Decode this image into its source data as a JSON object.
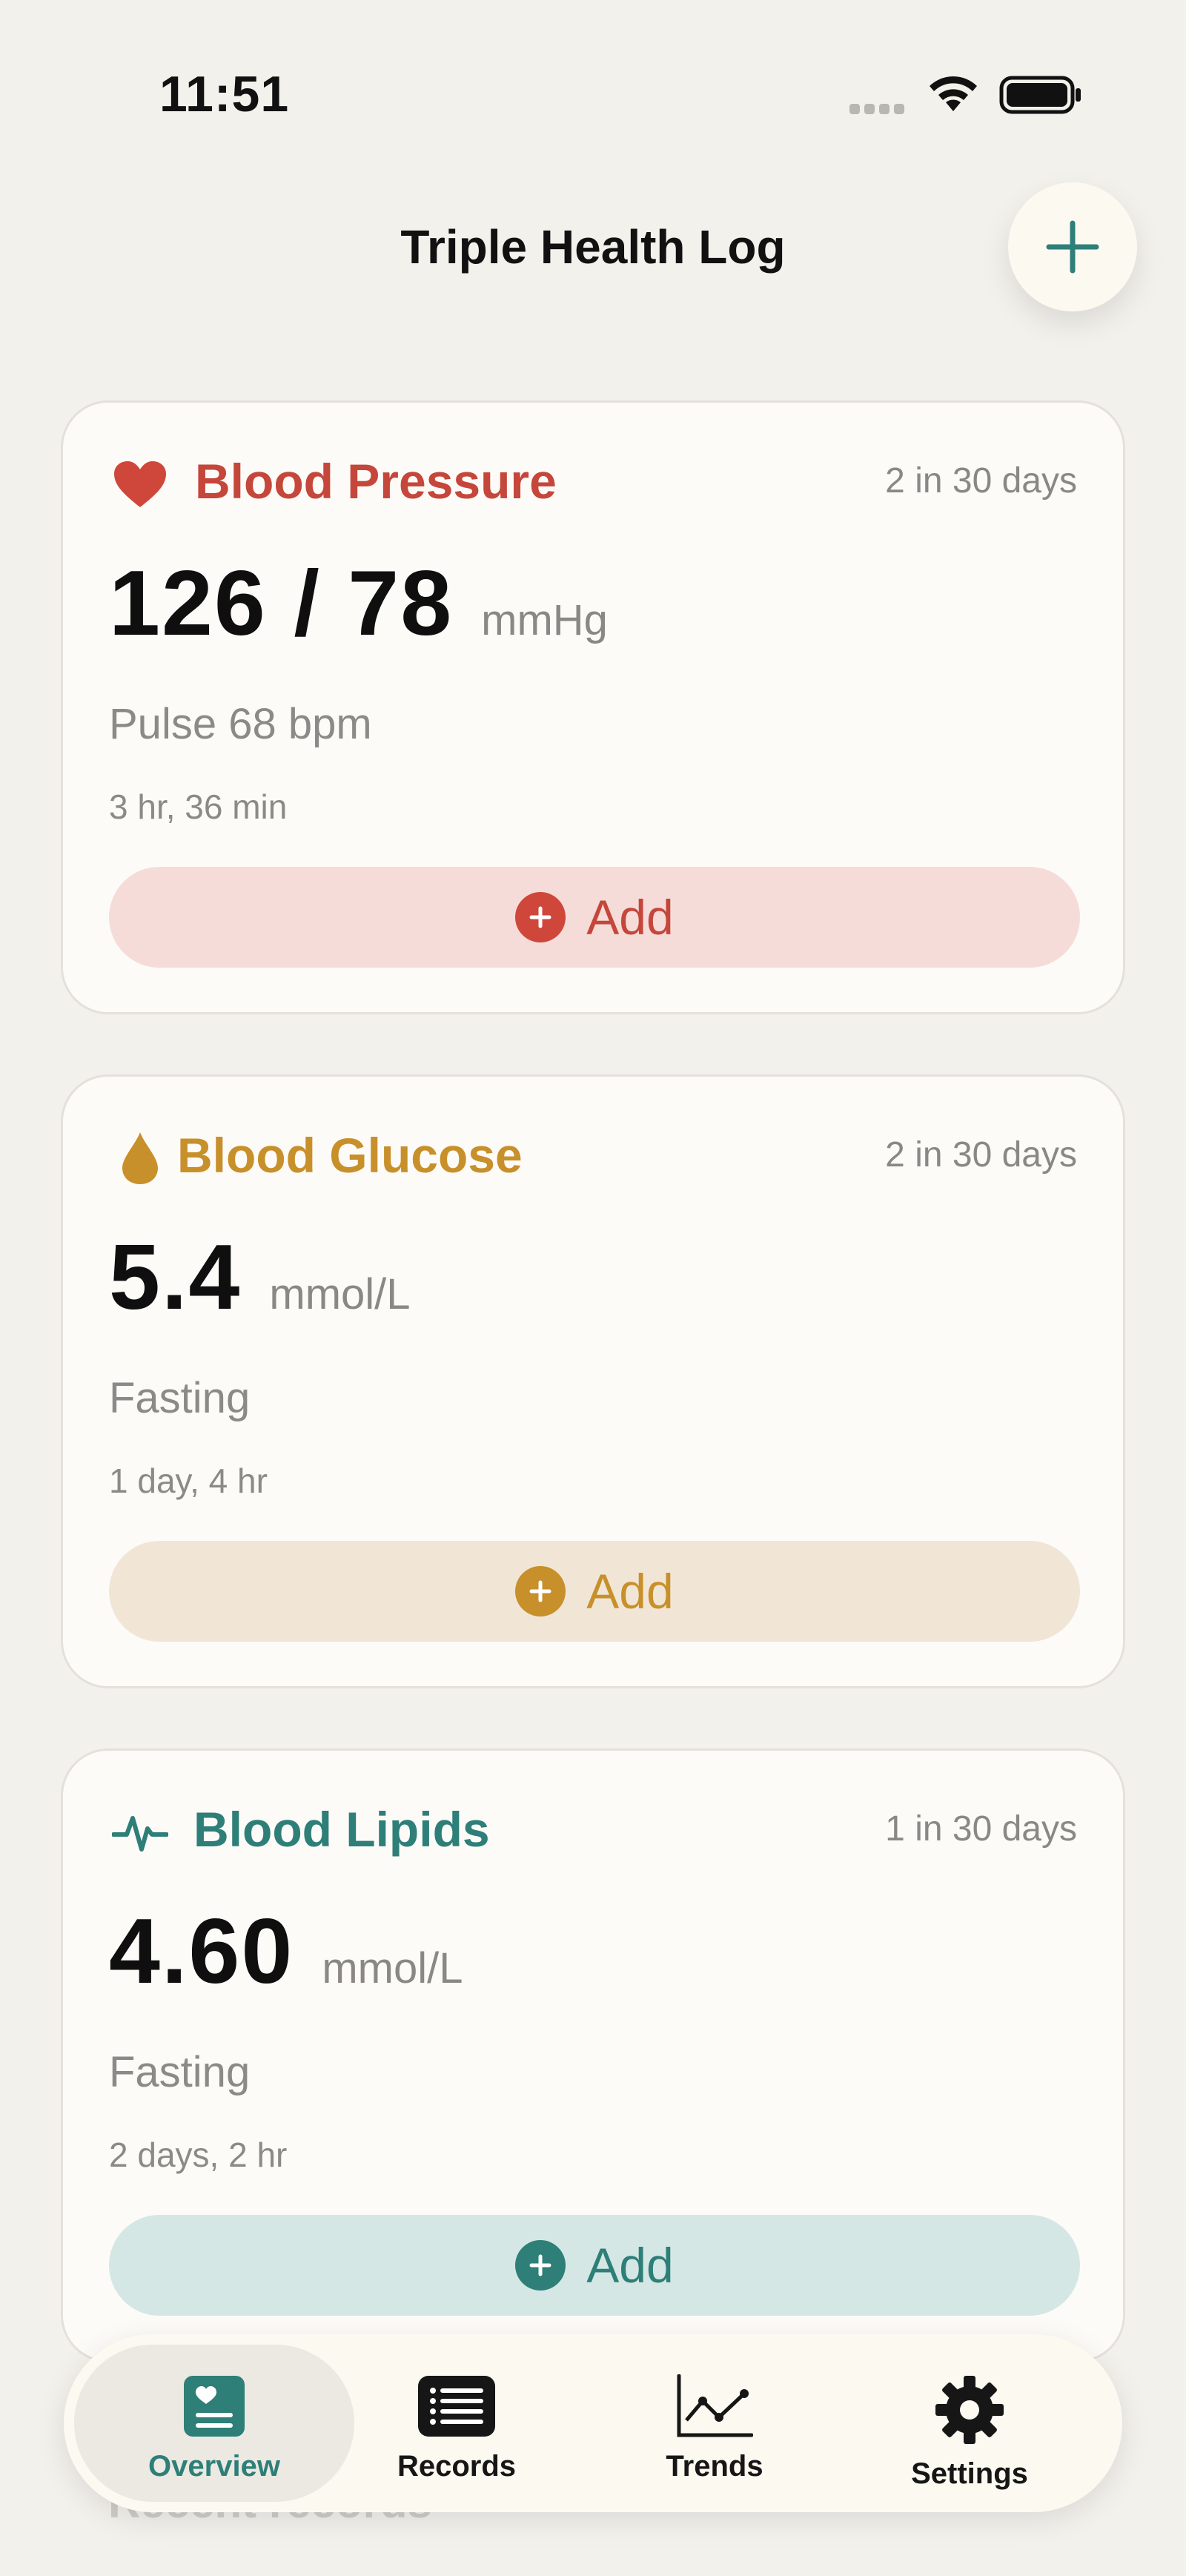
{
  "status_bar": {
    "time": "11:51"
  },
  "header": {
    "title": "Triple Health Log",
    "add_icon": "plus-icon"
  },
  "cards": [
    {
      "key": "blood-pressure",
      "title": "Blood Pressure",
      "icon": "heart-icon",
      "count": "2 in 30 days",
      "value": "126 / 78",
      "unit": "mmHg",
      "subtext": "Pulse 68 bpm",
      "elapsed": "3 hr, 36 min",
      "add_label": "Add",
      "accent": "#c5463a"
    },
    {
      "key": "blood-glucose",
      "title": "Blood Glucose",
      "icon": "droplet-icon",
      "count": "2 in 30 days",
      "value": "5.4",
      "unit": "mmol/L",
      "subtext": "Fasting",
      "elapsed": "1 day, 4 hr",
      "add_label": "Add",
      "accent": "#c8902a"
    },
    {
      "key": "blood-lipids",
      "title": "Blood Lipids",
      "icon": "pulse-icon",
      "count": "1 in 30 days",
      "value": "4.60",
      "unit": "mmol/L",
      "subtext": "Fasting",
      "elapsed": "2 days, 2 hr",
      "add_label": "Add",
      "accent": "#2d7f78"
    }
  ],
  "recent_heading": "Recent records",
  "tabs": [
    {
      "label": "Overview",
      "icon": "overview-icon",
      "active": true
    },
    {
      "label": "Records",
      "icon": "list-icon",
      "active": false
    },
    {
      "label": "Trends",
      "icon": "chart-icon",
      "active": false
    },
    {
      "label": "Settings",
      "icon": "gear-icon",
      "active": false
    }
  ],
  "colors": {
    "background": "#f3f1ec",
    "teal": "#2d7f78",
    "red": "#c5463a",
    "gold": "#c8902a"
  }
}
